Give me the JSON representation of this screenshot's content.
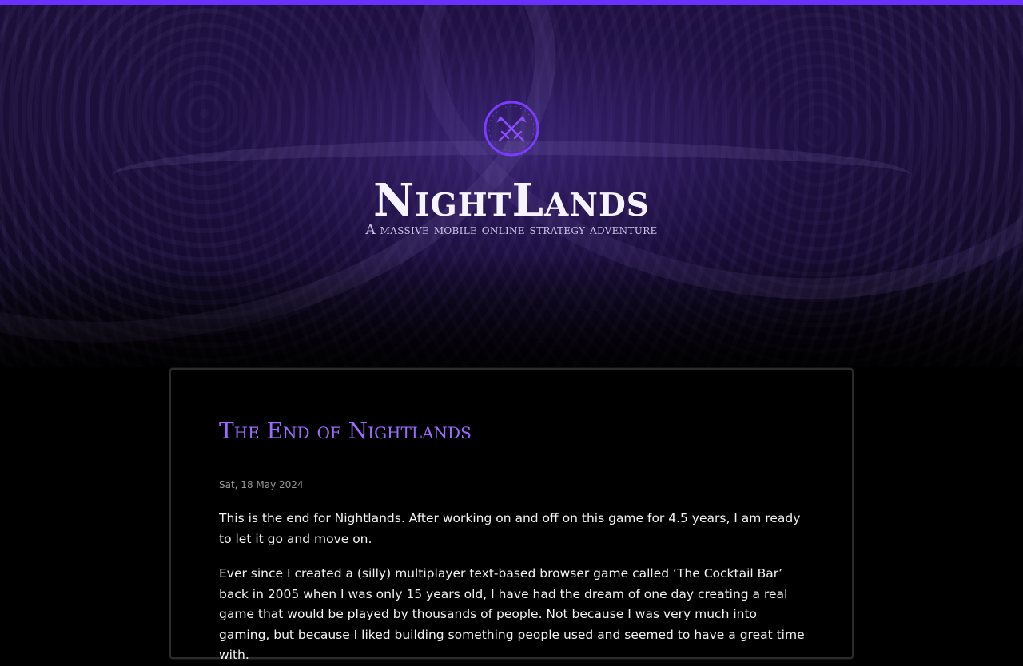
{
  "header": {
    "site_title": "NightLands",
    "tagline": "A massive mobile online strategy adventure",
    "logo_icon": "crossed-swords-icon"
  },
  "colors": {
    "accent": "#6a30ff",
    "title_accent": "#9b6bff",
    "background": "#000000"
  },
  "post": {
    "title": "The End of Nightlands",
    "date": "Sat, 18 May 2024",
    "paragraphs": [
      "This is the end for Nightlands. After working on and off on this game for 4.5 years, I am ready to let it go and move on.",
      "Ever since I created a (silly) multiplayer text-based browser game called ‘The Cocktail Bar’ back in 2005 when I was only 15 years old, I have had the dream of one day creating a real game that would be played by thousands of people. Not because I was very much into gaming, but because I liked building something people used and seemed to have a great time with."
    ]
  }
}
